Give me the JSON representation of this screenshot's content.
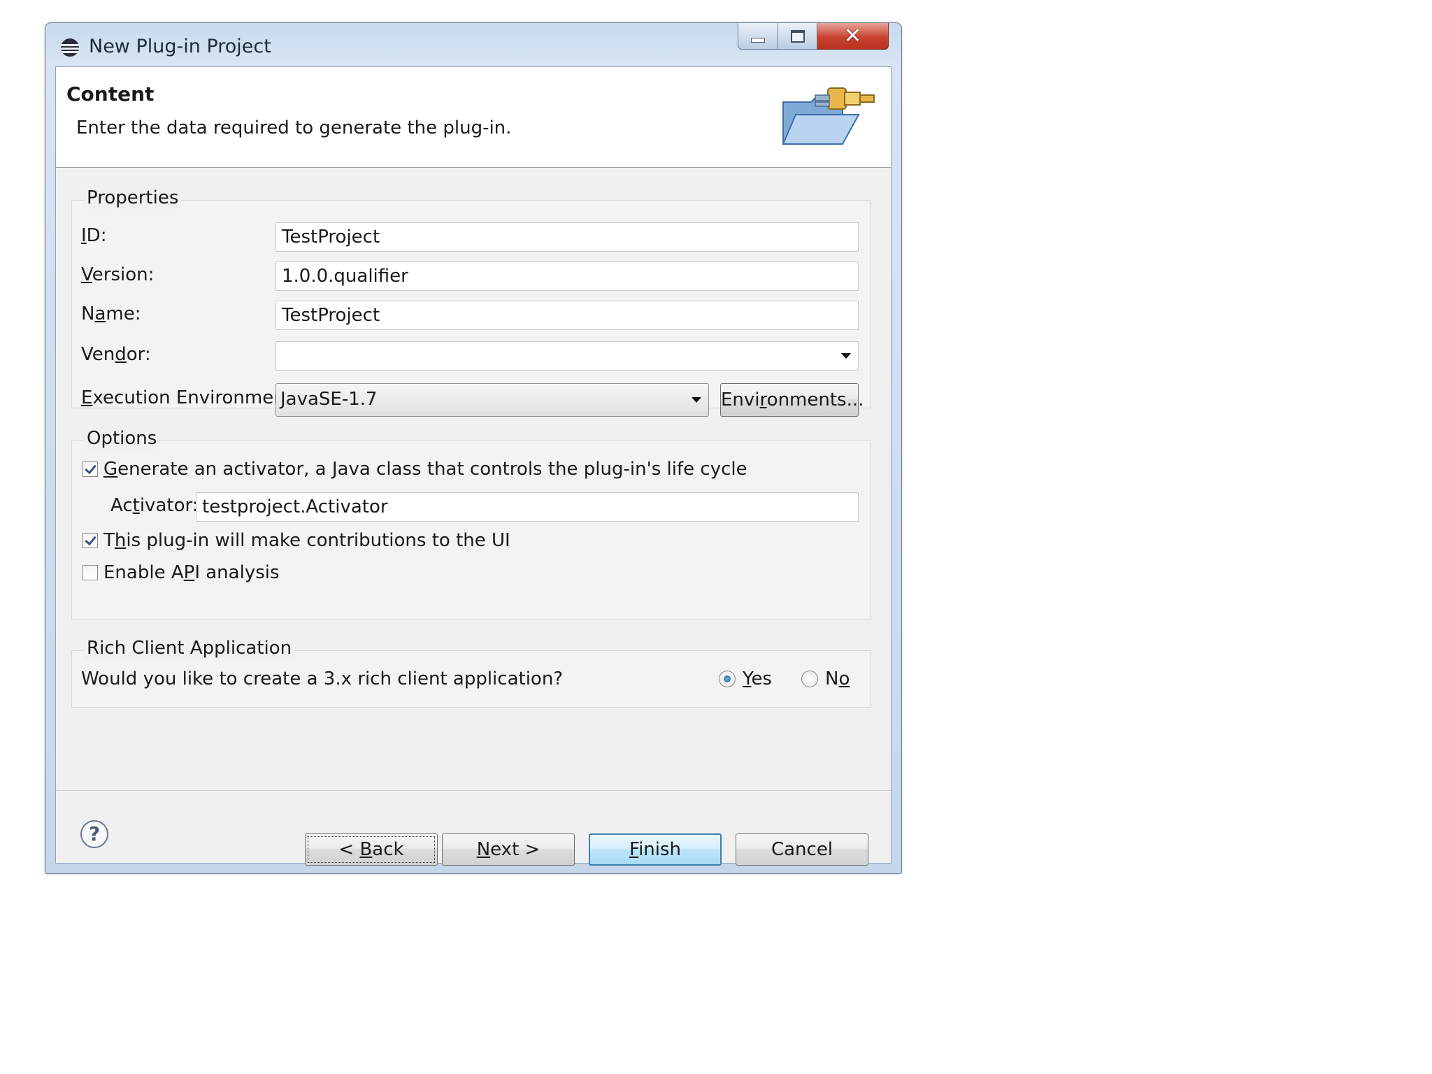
{
  "window": {
    "title": "New Plug-in Project",
    "icons": {
      "app": "eclipse-icon",
      "min": "minimize-icon",
      "max": "maximize-icon",
      "close": "close-icon"
    }
  },
  "header": {
    "title": "Content",
    "description": "Enter the data required to generate the plug-in.",
    "image": "plugin-folder-icon"
  },
  "properties": {
    "label": "Properties",
    "id": {
      "label": "ID:",
      "value": "TestProject"
    },
    "version": {
      "label": "Version:",
      "value": "1.0.0.qualifier"
    },
    "name": {
      "label": "Name:",
      "value": "TestProject"
    },
    "vendor": {
      "label": "Vendor:",
      "value": ""
    },
    "execution_environment": {
      "label": "Execution Environment:",
      "value": "JavaSE-1.7"
    },
    "environments_button": "Environments..."
  },
  "options": {
    "label": "Options",
    "generate_activator": {
      "label": "Generate an activator, a Java class that controls the plug-in's life cycle",
      "checked": true
    },
    "activator": {
      "label": "Activator:",
      "value": "testproject.Activator"
    },
    "ui_contributions": {
      "label": "This plug-in will make contributions to the UI",
      "checked": true
    },
    "api_analysis": {
      "label": "Enable API analysis",
      "checked": false
    }
  },
  "rca": {
    "label": "Rich Client Application",
    "question": "Would you like to create a 3.x rich client application?",
    "yes": "Yes",
    "no": "No",
    "selected": "Yes"
  },
  "buttons": {
    "help_icon": "help-icon",
    "back": "< Back",
    "next": "Next >",
    "finish": "Finish",
    "cancel": "Cancel"
  }
}
